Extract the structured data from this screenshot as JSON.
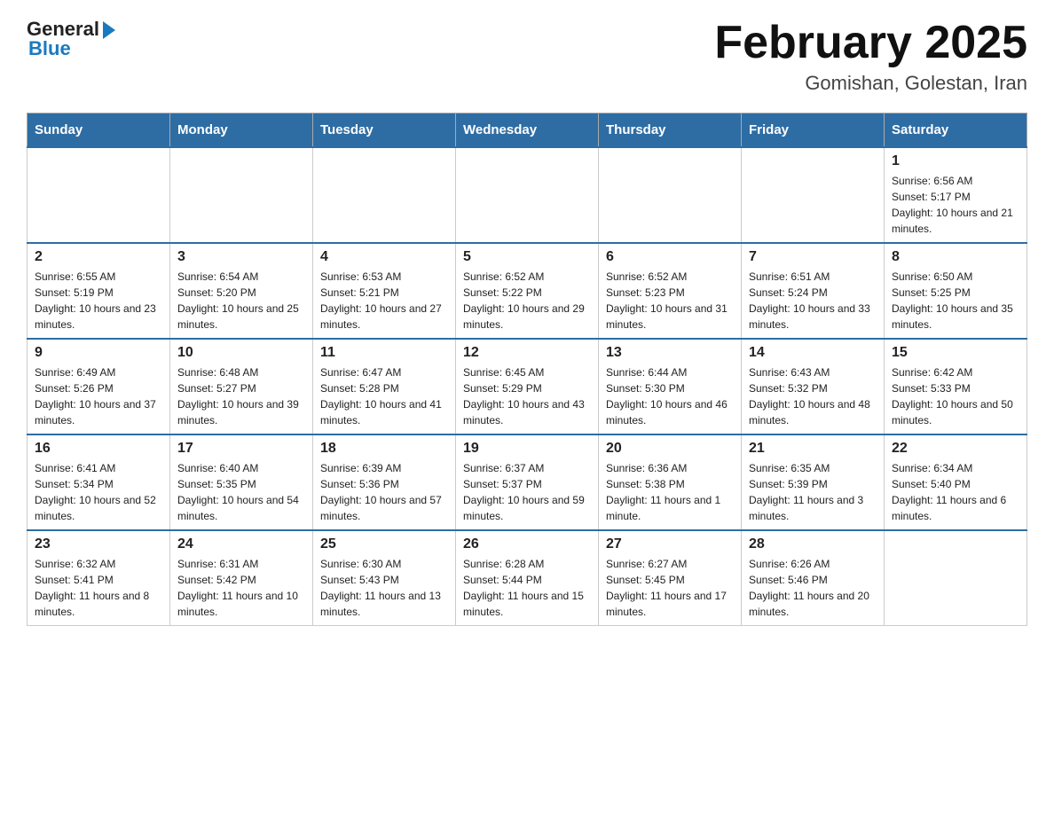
{
  "logo": {
    "general": "General",
    "blue": "Blue"
  },
  "title": "February 2025",
  "subtitle": "Gomishan, Golestan, Iran",
  "headers": [
    "Sunday",
    "Monday",
    "Tuesday",
    "Wednesday",
    "Thursday",
    "Friday",
    "Saturday"
  ],
  "weeks": [
    [
      {
        "day": "",
        "info": ""
      },
      {
        "day": "",
        "info": ""
      },
      {
        "day": "",
        "info": ""
      },
      {
        "day": "",
        "info": ""
      },
      {
        "day": "",
        "info": ""
      },
      {
        "day": "",
        "info": ""
      },
      {
        "day": "1",
        "info": "Sunrise: 6:56 AM\nSunset: 5:17 PM\nDaylight: 10 hours and 21 minutes."
      }
    ],
    [
      {
        "day": "2",
        "info": "Sunrise: 6:55 AM\nSunset: 5:19 PM\nDaylight: 10 hours and 23 minutes."
      },
      {
        "day": "3",
        "info": "Sunrise: 6:54 AM\nSunset: 5:20 PM\nDaylight: 10 hours and 25 minutes."
      },
      {
        "day": "4",
        "info": "Sunrise: 6:53 AM\nSunset: 5:21 PM\nDaylight: 10 hours and 27 minutes."
      },
      {
        "day": "5",
        "info": "Sunrise: 6:52 AM\nSunset: 5:22 PM\nDaylight: 10 hours and 29 minutes."
      },
      {
        "day": "6",
        "info": "Sunrise: 6:52 AM\nSunset: 5:23 PM\nDaylight: 10 hours and 31 minutes."
      },
      {
        "day": "7",
        "info": "Sunrise: 6:51 AM\nSunset: 5:24 PM\nDaylight: 10 hours and 33 minutes."
      },
      {
        "day": "8",
        "info": "Sunrise: 6:50 AM\nSunset: 5:25 PM\nDaylight: 10 hours and 35 minutes."
      }
    ],
    [
      {
        "day": "9",
        "info": "Sunrise: 6:49 AM\nSunset: 5:26 PM\nDaylight: 10 hours and 37 minutes."
      },
      {
        "day": "10",
        "info": "Sunrise: 6:48 AM\nSunset: 5:27 PM\nDaylight: 10 hours and 39 minutes."
      },
      {
        "day": "11",
        "info": "Sunrise: 6:47 AM\nSunset: 5:28 PM\nDaylight: 10 hours and 41 minutes."
      },
      {
        "day": "12",
        "info": "Sunrise: 6:45 AM\nSunset: 5:29 PM\nDaylight: 10 hours and 43 minutes."
      },
      {
        "day": "13",
        "info": "Sunrise: 6:44 AM\nSunset: 5:30 PM\nDaylight: 10 hours and 46 minutes."
      },
      {
        "day": "14",
        "info": "Sunrise: 6:43 AM\nSunset: 5:32 PM\nDaylight: 10 hours and 48 minutes."
      },
      {
        "day": "15",
        "info": "Sunrise: 6:42 AM\nSunset: 5:33 PM\nDaylight: 10 hours and 50 minutes."
      }
    ],
    [
      {
        "day": "16",
        "info": "Sunrise: 6:41 AM\nSunset: 5:34 PM\nDaylight: 10 hours and 52 minutes."
      },
      {
        "day": "17",
        "info": "Sunrise: 6:40 AM\nSunset: 5:35 PM\nDaylight: 10 hours and 54 minutes."
      },
      {
        "day": "18",
        "info": "Sunrise: 6:39 AM\nSunset: 5:36 PM\nDaylight: 10 hours and 57 minutes."
      },
      {
        "day": "19",
        "info": "Sunrise: 6:37 AM\nSunset: 5:37 PM\nDaylight: 10 hours and 59 minutes."
      },
      {
        "day": "20",
        "info": "Sunrise: 6:36 AM\nSunset: 5:38 PM\nDaylight: 11 hours and 1 minute."
      },
      {
        "day": "21",
        "info": "Sunrise: 6:35 AM\nSunset: 5:39 PM\nDaylight: 11 hours and 3 minutes."
      },
      {
        "day": "22",
        "info": "Sunrise: 6:34 AM\nSunset: 5:40 PM\nDaylight: 11 hours and 6 minutes."
      }
    ],
    [
      {
        "day": "23",
        "info": "Sunrise: 6:32 AM\nSunset: 5:41 PM\nDaylight: 11 hours and 8 minutes."
      },
      {
        "day": "24",
        "info": "Sunrise: 6:31 AM\nSunset: 5:42 PM\nDaylight: 11 hours and 10 minutes."
      },
      {
        "day": "25",
        "info": "Sunrise: 6:30 AM\nSunset: 5:43 PM\nDaylight: 11 hours and 13 minutes."
      },
      {
        "day": "26",
        "info": "Sunrise: 6:28 AM\nSunset: 5:44 PM\nDaylight: 11 hours and 15 minutes."
      },
      {
        "day": "27",
        "info": "Sunrise: 6:27 AM\nSunset: 5:45 PM\nDaylight: 11 hours and 17 minutes."
      },
      {
        "day": "28",
        "info": "Sunrise: 6:26 AM\nSunset: 5:46 PM\nDaylight: 11 hours and 20 minutes."
      },
      {
        "day": "",
        "info": ""
      }
    ]
  ]
}
